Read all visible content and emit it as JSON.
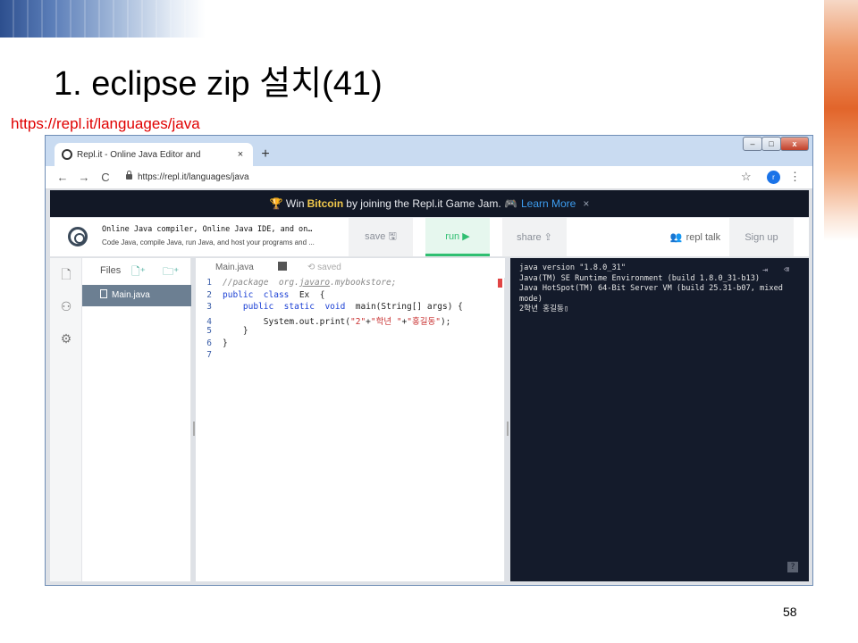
{
  "slide": {
    "title": "1. eclipse zip 설치(41)",
    "url": "https://repl.it/languages/java",
    "page_number": "58"
  },
  "browser": {
    "tab_title": "Repl.it - Online Java Editor and",
    "tab_close": "×",
    "new_tab": "+",
    "address": "https://repl.it/languages/java",
    "profile_initial": "r",
    "win_min": "–",
    "win_max": "□",
    "win_close": "x",
    "back": "←",
    "forward": "→",
    "reload": "C",
    "star": "☆",
    "menu": "⋮"
  },
  "banner": {
    "prefix": "🏆 Win",
    "highlight": "Bitcoin",
    "middle": "by joining the Repl.it Game Jam. 🎮",
    "link": "Learn More",
    "close": "×"
  },
  "app": {
    "title": "Online Java compiler, Online Java IDE, and on…",
    "description": "Code Java, compile Java, run Java, and host your programs and ...",
    "save_label": "save 🖫",
    "run_label": "run ▶",
    "share_label": "share ⇪",
    "talk_label": "repl talk",
    "signup_label": "Sign up"
  },
  "files": {
    "label": "Files",
    "items": [
      {
        "name": "Main.java"
      }
    ]
  },
  "editor": {
    "tab": "Main.java",
    "saved": "saved",
    "lines": [
      {
        "n": "1"
      },
      {
        "n": "2"
      },
      {
        "n": "3"
      },
      {
        "n": "4"
      },
      {
        "n": "5"
      },
      {
        "n": "6"
      },
      {
        "n": "7"
      }
    ]
  },
  "console": {
    "lines": [
      "java version \"1.8.0_31\"",
      "Java(TM) SE Runtime Environment (build 1.8.0_31-b13)",
      "Java HotSpot(TM) 64-Bit Server VM (build 25.31-b07, mixed mode)",
      "2학년 홍길동▯"
    ]
  },
  "colors": {
    "banner_bg": "#121826",
    "console_bg": "#141b2b",
    "run_green": "#2fbf71",
    "url_red": "#e00000"
  }
}
